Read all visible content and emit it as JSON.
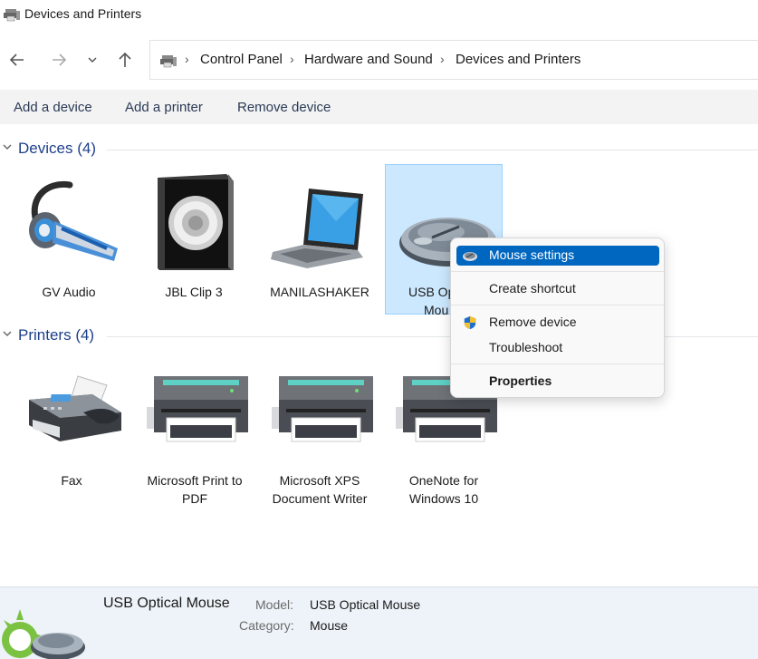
{
  "window": {
    "title": "Devices and Printers"
  },
  "icons": {
    "back": "arrow-left-icon",
    "forward": "arrow-right-icon",
    "recent": "chevron-down-icon",
    "up": "arrow-up-icon",
    "location": "devices-printers-icon",
    "separator": "chevron-right-icon",
    "group_toggle": "chevron-down-icon",
    "menu_mouse": "mouse-icon",
    "menu_shield": "shield-icon"
  },
  "breadcrumb": [
    "Control Panel",
    "Hardware and Sound",
    "Devices and Printers"
  ],
  "commands": {
    "add_device": "Add a device",
    "add_printer": "Add a printer",
    "remove_device": "Remove device"
  },
  "groups": {
    "devices": {
      "title": "Devices",
      "count": "(4)"
    },
    "printers": {
      "title": "Printers",
      "count": "(4)"
    }
  },
  "devices": [
    {
      "label": "GV Audio",
      "icon": "headset-icon"
    },
    {
      "label": "JBL Clip 3",
      "icon": "speaker-icon"
    },
    {
      "label": "MANILASHAKER",
      "icon": "laptop-icon"
    },
    {
      "label_line1": "USB Op",
      "label_line2": "Mou",
      "icon": "mouse-icon",
      "selected": true
    }
  ],
  "printers": [
    {
      "line1": "Fax",
      "line2": "",
      "icon": "fax-icon"
    },
    {
      "line1": "Microsoft Print to",
      "line2": "PDF",
      "icon": "printer-icon"
    },
    {
      "line1": "Microsoft XPS",
      "line2": "Document Writer",
      "icon": "printer-icon"
    },
    {
      "line1": "OneNote for",
      "line2": "Windows 10",
      "icon": "printer-icon"
    }
  ],
  "context_menu": {
    "mouse_settings": "Mouse settings",
    "create_shortcut": "Create shortcut",
    "remove_device": "Remove device",
    "troubleshoot": "Troubleshoot",
    "properties": "Properties"
  },
  "details": {
    "name": "USB Optical Mouse",
    "model_label": "Model:",
    "model_value": "USB Optical Mouse",
    "category_label": "Category:",
    "category_value": "Mouse"
  },
  "colors": {
    "accent": "#0067c0",
    "selection_bg": "#cce8ff",
    "group_title": "#1e3f8a"
  }
}
